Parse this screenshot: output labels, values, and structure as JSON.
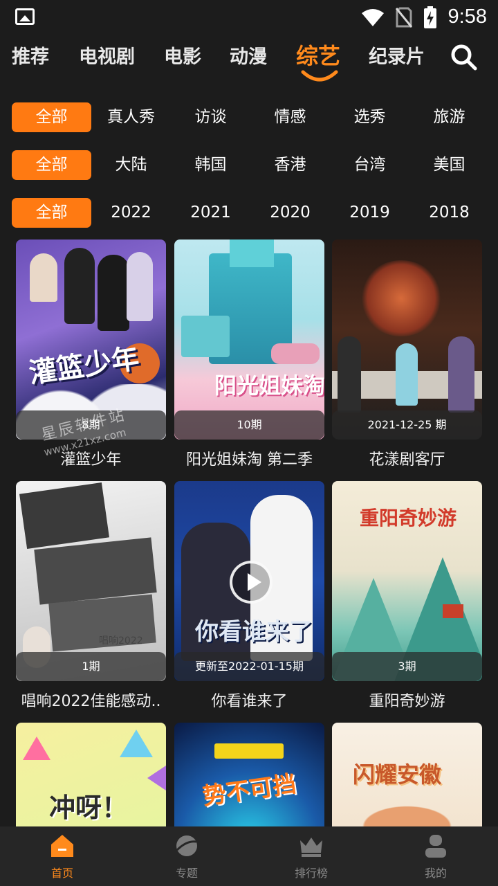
{
  "status_bar": {
    "time": "9:58"
  },
  "top_nav": {
    "tabs": [
      "推荐",
      "电视剧",
      "电影",
      "动漫",
      "综艺",
      "纪录片"
    ],
    "active_index": 4,
    "accent_color": "#ff8a1c"
  },
  "filters": {
    "type": [
      "全部",
      "真人秀",
      "访谈",
      "情感",
      "选秀",
      "旅游"
    ],
    "region": [
      "全部",
      "大陆",
      "韩国",
      "香港",
      "台湾",
      "美国"
    ],
    "year": [
      "全部",
      "2022",
      "2021",
      "2020",
      "2019",
      "2018"
    ]
  },
  "grid": {
    "items": [
      {
        "title": "灌篮少年",
        "badge": "8期",
        "poster_text": "灌篮少年"
      },
      {
        "title": "阳光姐妹淘 第二季",
        "badge": "10期",
        "poster_text": "阳光姐妹淘"
      },
      {
        "title": "花漾剧客厅",
        "badge": "2021-12-25 期",
        "poster_text": ""
      },
      {
        "title": "唱响2022佳能感动..",
        "badge": "1期",
        "poster_text": "唱响2022"
      },
      {
        "title": "你看谁来了",
        "badge": "更新至2022-01-15期",
        "poster_text": "你看谁来了"
      },
      {
        "title": "重阳奇妙游",
        "badge": "3期",
        "poster_text": "重阳奇妙游"
      },
      {
        "title": "",
        "badge": "",
        "poster_text": "冲呀！"
      },
      {
        "title": "",
        "badge": "",
        "poster_text": "势不可挡"
      },
      {
        "title": "",
        "badge": "",
        "poster_text": "闪耀安徽"
      }
    ]
  },
  "watermark": {
    "line1": "星辰软件站",
    "line2": "www.x21xz.com"
  },
  "bottom_nav": {
    "items": [
      {
        "label": "首页",
        "icon": "home-icon"
      },
      {
        "label": "专题",
        "icon": "planet-icon"
      },
      {
        "label": "排行榜",
        "icon": "crown-icon"
      },
      {
        "label": "我的",
        "icon": "user-icon"
      }
    ],
    "active_index": 0
  }
}
